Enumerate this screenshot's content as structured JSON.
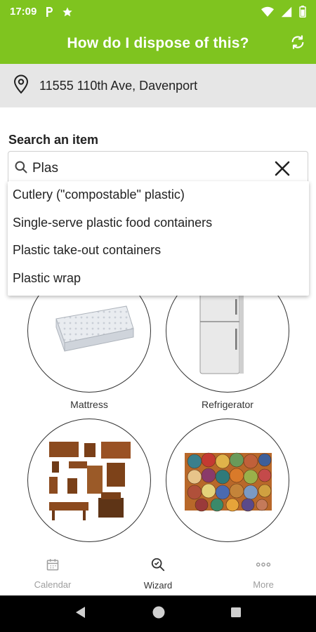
{
  "status_bar": {
    "time": "17:09",
    "icons": [
      "parking-icon",
      "star-icon",
      "wifi-icon",
      "signal-icon",
      "battery-icon"
    ]
  },
  "app_bar": {
    "title": "How do I dispose of this?",
    "action_icon": "refresh-icon"
  },
  "location": {
    "icon": "location-pin-icon",
    "address": "11555 110th Ave, Davenport"
  },
  "search": {
    "label": "Search an item",
    "value": "Plas",
    "icon": "search-icon",
    "clear_icon": "close-icon"
  },
  "suggestions": [
    "Cutlery (\"compostable\" plastic)",
    "Single-serve plastic food containers",
    "Plastic take-out containers",
    "Plastic wrap"
  ],
  "categories": [
    {
      "label": "Mattress",
      "image": "mattress"
    },
    {
      "label": "Refrigerator",
      "image": "refrigerator"
    },
    {
      "label": "",
      "image": "furniture"
    },
    {
      "label": "",
      "image": "rugs"
    }
  ],
  "bottom_nav": [
    {
      "label": "Calendar",
      "icon": "calendar-icon",
      "active": false
    },
    {
      "label": "Wizard",
      "icon": "wizard-search-icon",
      "active": true
    },
    {
      "label": "More",
      "icon": "more-dots-icon",
      "active": false
    }
  ],
  "colors": {
    "primary": "#7fc41f",
    "location_bg": "#e6e6e6",
    "inactive_nav": "#9e9e9e"
  }
}
